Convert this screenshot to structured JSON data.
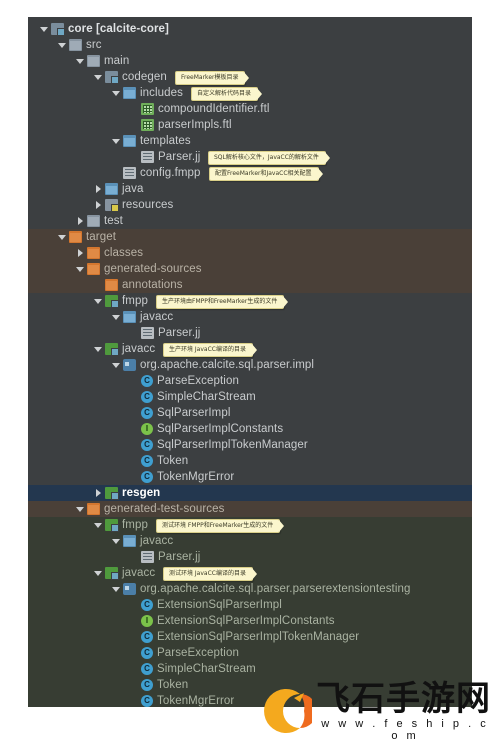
{
  "panel": {
    "title": "project-tree-panel",
    "background": "#3c3f41",
    "selection_color": "#23374f",
    "target_band_color": "#4a4038",
    "test_band_color": "#373d33"
  },
  "tree": [
    {
      "label": "core [calcite-core]",
      "depth": 0,
      "arrow": "down",
      "icon": "module",
      "style": "bold"
    },
    {
      "label": "src",
      "depth": 1,
      "arrow": "down",
      "icon": "folder",
      "style": "normal"
    },
    {
      "label": "main",
      "depth": 2,
      "arrow": "down",
      "icon": "folder",
      "style": "normal"
    },
    {
      "label": "codegen",
      "depth": 3,
      "arrow": "down",
      "icon": "module",
      "style": "normal",
      "tip": "FreeMarker模板目录"
    },
    {
      "label": "includes",
      "depth": 4,
      "arrow": "down",
      "icon": "srcfolder",
      "style": "normal",
      "tip": "自定义解析代码目录"
    },
    {
      "label": "compoundIdentifier.ftl",
      "depth": 5,
      "arrow": "none",
      "icon": "ftl",
      "style": "normal"
    },
    {
      "label": "parserImpls.ftl",
      "depth": 5,
      "arrow": "none",
      "icon": "ftl",
      "style": "normal"
    },
    {
      "label": "templates",
      "depth": 4,
      "arrow": "down",
      "icon": "srcfolder",
      "style": "normal"
    },
    {
      "label": "Parser.jj",
      "depth": 5,
      "arrow": "none",
      "icon": "file",
      "style": "normal",
      "tip": "SQL解析核心文件，JavaCC的解析文件"
    },
    {
      "label": "config.fmpp",
      "depth": 4,
      "arrow": "none",
      "icon": "file",
      "style": "normal",
      "tip": "配置FreeMarker和JavaCC相关配置"
    },
    {
      "label": "java",
      "depth": 3,
      "arrow": "right",
      "icon": "srcfolder",
      "style": "normal"
    },
    {
      "label": "resources",
      "depth": 3,
      "arrow": "right",
      "icon": "resfolder",
      "style": "normal"
    },
    {
      "label": "test",
      "depth": 2,
      "arrow": "right",
      "icon": "folder",
      "style": "normal"
    },
    {
      "label": "target",
      "depth": 1,
      "arrow": "down",
      "icon": "orange",
      "style": "dimorange",
      "band": "target"
    },
    {
      "label": "classes",
      "depth": 2,
      "arrow": "right",
      "icon": "orange",
      "style": "dimorange",
      "band": "target"
    },
    {
      "label": "generated-sources",
      "depth": 2,
      "arrow": "down",
      "icon": "orange",
      "style": "dimorange",
      "band": "target"
    },
    {
      "label": "annotations",
      "depth": 3,
      "arrow": "none",
      "icon": "orange",
      "style": "dimorange",
      "band": "target"
    },
    {
      "label": "fmpp",
      "depth": 3,
      "arrow": "down",
      "icon": "green",
      "style": "normal",
      "tip": "生产环境由FMPP和FreeMarker生成的文件"
    },
    {
      "label": "javacc",
      "depth": 4,
      "arrow": "down",
      "icon": "srcfolder",
      "style": "normal"
    },
    {
      "label": "Parser.jj",
      "depth": 5,
      "arrow": "none",
      "icon": "file",
      "style": "normal"
    },
    {
      "label": "javacc",
      "depth": 3,
      "arrow": "down",
      "icon": "green",
      "style": "normal",
      "tip": "生产环境 JavaCC编译的目录"
    },
    {
      "label": "org.apache.calcite.sql.parser.impl",
      "depth": 4,
      "arrow": "down",
      "icon": "package",
      "style": "normal"
    },
    {
      "label": "ParseException",
      "depth": 5,
      "arrow": "none",
      "icon": "cls",
      "glyph": "C",
      "style": "normal"
    },
    {
      "label": "SimpleCharStream",
      "depth": 5,
      "arrow": "none",
      "icon": "cls",
      "glyph": "C",
      "style": "normal"
    },
    {
      "label": "SqlParserImpl",
      "depth": 5,
      "arrow": "none",
      "icon": "cls",
      "glyph": "C",
      "style": "normal"
    },
    {
      "label": "SqlParserImplConstants",
      "depth": 5,
      "arrow": "none",
      "icon": "iface",
      "glyph": "I",
      "style": "normal"
    },
    {
      "label": "SqlParserImplTokenManager",
      "depth": 5,
      "arrow": "none",
      "icon": "cls",
      "glyph": "C",
      "style": "normal"
    },
    {
      "label": "Token",
      "depth": 5,
      "arrow": "none",
      "icon": "cls",
      "glyph": "C",
      "style": "normal"
    },
    {
      "label": "TokenMgrError",
      "depth": 5,
      "arrow": "none",
      "icon": "cls",
      "glyph": "C",
      "style": "normal"
    },
    {
      "label": "resgen",
      "depth": 3,
      "arrow": "right",
      "icon": "green",
      "style": "selected",
      "selected": true
    },
    {
      "label": "generated-test-sources",
      "depth": 2,
      "arrow": "down",
      "icon": "orange",
      "style": "dimorange",
      "band": "target2"
    },
    {
      "label": "fmpp",
      "depth": 3,
      "arrow": "down",
      "icon": "green",
      "style": "dimgreen",
      "band": "test",
      "tip": "测试环境 FMPP和FreeMarker生成的文件"
    },
    {
      "label": "javacc",
      "depth": 4,
      "arrow": "down",
      "icon": "srcfolder",
      "style": "dimgreen",
      "band": "test"
    },
    {
      "label": "Parser.jj",
      "depth": 5,
      "arrow": "none",
      "icon": "file",
      "style": "dimgreen",
      "band": "test"
    },
    {
      "label": "javacc",
      "depth": 3,
      "arrow": "down",
      "icon": "green",
      "style": "dimgreen",
      "band": "test",
      "tip": "测试环境 JavaCC编译的目录"
    },
    {
      "label": "org.apache.calcite.sql.parser.parserextensiontesting",
      "depth": 4,
      "arrow": "down",
      "icon": "package",
      "style": "dimgreen",
      "band": "test"
    },
    {
      "label": "ExtensionSqlParserImpl",
      "depth": 5,
      "arrow": "none",
      "icon": "cls",
      "glyph": "C",
      "style": "dimgreen",
      "band": "test"
    },
    {
      "label": "ExtensionSqlParserImplConstants",
      "depth": 5,
      "arrow": "none",
      "icon": "iface",
      "glyph": "I",
      "style": "dimgreen",
      "band": "test"
    },
    {
      "label": "ExtensionSqlParserImplTokenManager",
      "depth": 5,
      "arrow": "none",
      "icon": "cls",
      "glyph": "C",
      "style": "dimgreen",
      "band": "test"
    },
    {
      "label": "ParseException",
      "depth": 5,
      "arrow": "none",
      "icon": "cls",
      "glyph": "C",
      "style": "dimgreen",
      "band": "test"
    },
    {
      "label": "SimpleCharStream",
      "depth": 5,
      "arrow": "none",
      "icon": "cls",
      "glyph": "C",
      "style": "dimgreen",
      "band": "test"
    },
    {
      "label": "Token",
      "depth": 5,
      "arrow": "none",
      "icon": "cls",
      "glyph": "C",
      "style": "dimgreen",
      "band": "test"
    },
    {
      "label": "TokenMgrError",
      "depth": 5,
      "arrow": "none",
      "icon": "cls",
      "glyph": "C",
      "style": "dimgreen",
      "band": "test"
    }
  ],
  "watermark": {
    "brand_cn": "飞石手游网",
    "url": "w w w . f e s h i p . c o m"
  }
}
